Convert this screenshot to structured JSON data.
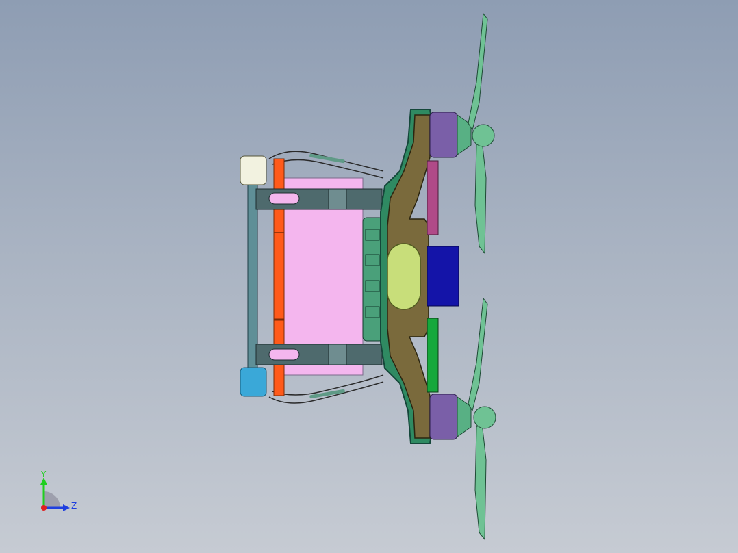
{
  "viewport": {
    "background_top": "#8e9db3",
    "background_bottom": "#c6cbd3"
  },
  "model": {
    "colors": {
      "frame_green": "#2f8a62",
      "frame_dark": "#15473a",
      "body_olive": "#7a6a3c",
      "motor_purple": "#7a5fa8",
      "propeller_green": "#6fc294",
      "battery_pink": "#f4b6ee",
      "rail_orange": "#ff5a1a",
      "bracket_slate": "#4e6a6d",
      "canopy_yellow": "#c8de7a",
      "payload_blue": "#1414a8",
      "side_pink": "#b04a88",
      "side_green": "#16a83c",
      "cap_white": "#f2f2e0",
      "cap_cyan": "#3aa8d8"
    }
  },
  "triad": {
    "y_label": "Y",
    "z_label": "Z",
    "y_color": "#1fcf1f",
    "z_color": "#1f3fdf",
    "x_color": "#df1f1f"
  }
}
